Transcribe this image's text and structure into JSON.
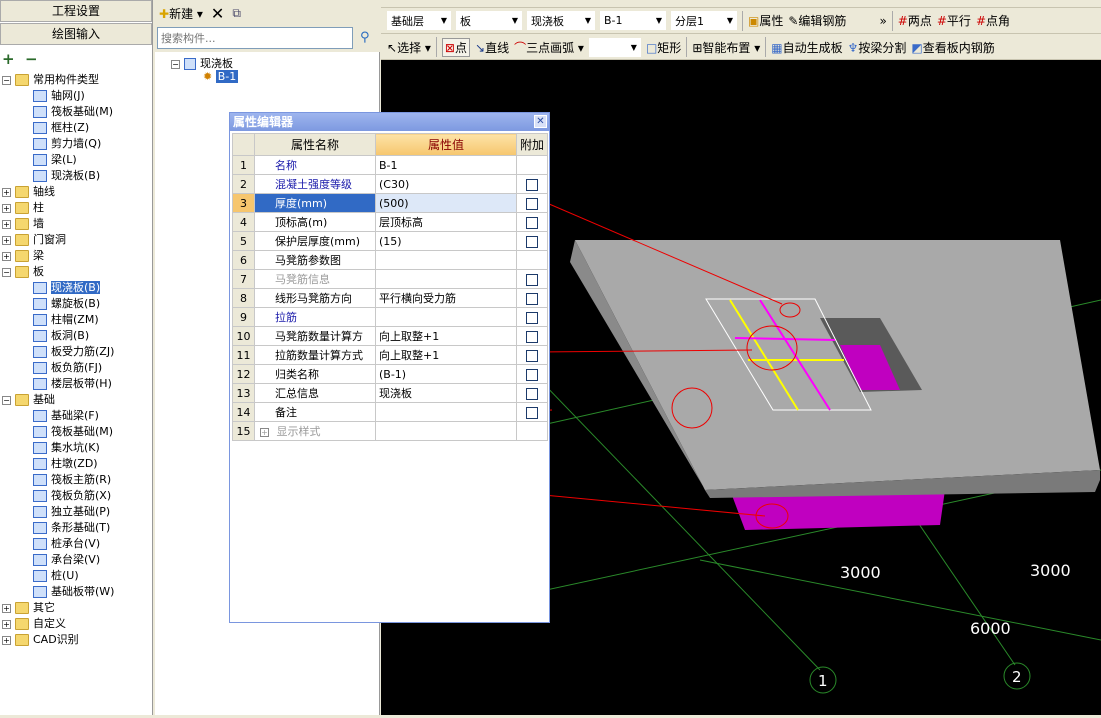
{
  "left": {
    "btn_project": "工程设置",
    "btn_draw": "绘图输入",
    "toolbar": [
      "+",
      "−"
    ],
    "tree": [
      {
        "label": "常用构件类型",
        "level": 0,
        "type": "folder",
        "expanded": true
      },
      {
        "label": "轴网(J)",
        "level": 1
      },
      {
        "label": "筏板基础(M)",
        "level": 1
      },
      {
        "label": "框柱(Z)",
        "level": 1
      },
      {
        "label": "剪力墙(Q)",
        "level": 1
      },
      {
        "label": "梁(L)",
        "level": 1
      },
      {
        "label": "现浇板(B)",
        "level": 1
      },
      {
        "label": "轴线",
        "level": 0,
        "type": "folder"
      },
      {
        "label": "柱",
        "level": 0,
        "type": "folder"
      },
      {
        "label": "墙",
        "level": 0,
        "type": "folder"
      },
      {
        "label": "门窗洞",
        "level": 0,
        "type": "folder"
      },
      {
        "label": "梁",
        "level": 0,
        "type": "folder"
      },
      {
        "label": "板",
        "level": 0,
        "type": "folder",
        "expanded": true
      },
      {
        "label": "现浇板(B)",
        "level": 1,
        "selected": true
      },
      {
        "label": "螺旋板(B)",
        "level": 1
      },
      {
        "label": "柱帽(ZM)",
        "level": 1
      },
      {
        "label": "板洞(B)",
        "level": 1
      },
      {
        "label": "板受力筋(ZJ)",
        "level": 1
      },
      {
        "label": "板负筋(FJ)",
        "level": 1
      },
      {
        "label": "楼层板带(H)",
        "level": 1
      },
      {
        "label": "基础",
        "level": 0,
        "type": "folder",
        "expanded": true
      },
      {
        "label": "基础梁(F)",
        "level": 1
      },
      {
        "label": "筏板基础(M)",
        "level": 1
      },
      {
        "label": "集水坑(K)",
        "level": 1
      },
      {
        "label": "柱墩(ZD)",
        "level": 1
      },
      {
        "label": "筏板主筋(R)",
        "level": 1
      },
      {
        "label": "筏板负筋(X)",
        "level": 1
      },
      {
        "label": "独立基础(P)",
        "level": 1
      },
      {
        "label": "条形基础(T)",
        "level": 1
      },
      {
        "label": "桩承台(V)",
        "level": 1
      },
      {
        "label": "承台梁(V)",
        "level": 1
      },
      {
        "label": "桩(U)",
        "level": 1
      },
      {
        "label": "基础板带(W)",
        "level": 1
      },
      {
        "label": "其它",
        "level": 0,
        "type": "folder"
      },
      {
        "label": "自定义",
        "level": 0,
        "type": "folder"
      },
      {
        "label": "CAD识别",
        "level": 0,
        "type": "folder"
      }
    ]
  },
  "mid": {
    "new_label": "新建",
    "search_placeholder": "搜索构件...",
    "tree_root": "现浇板",
    "tree_child": "B-1"
  },
  "toolbar2": {
    "layer": "基础层",
    "type": "板",
    "sub": "现浇板",
    "item": "B-1",
    "floor": "分层1",
    "props": "属性",
    "edit_rebar": "编辑钢筋",
    "more": "»",
    "two_point": "两点",
    "parallel": "平行",
    "point_angle": "点角"
  },
  "toolbar3": {
    "select": "选择",
    "point": "点",
    "line": "直线",
    "arc": "三点画弧",
    "rect": "矩形",
    "smart": "智能布置",
    "auto": "自动生成板",
    "split": "按梁分割",
    "view_rebar": "查看板内钢筋"
  },
  "dialog": {
    "title": "属性编辑器",
    "headers": [
      "属性名称",
      "属性值",
      "附加"
    ],
    "rows": [
      {
        "n": "1",
        "name": "名称",
        "value": "B-1",
        "style": "blue",
        "check": false
      },
      {
        "n": "2",
        "name": "混凝土强度等级",
        "value": "(C30)",
        "style": "blue",
        "check": true
      },
      {
        "n": "3",
        "name": "厚度(mm)",
        "value": "(500)",
        "style": "blue",
        "check": true,
        "current": true
      },
      {
        "n": "4",
        "name": "顶标高(m)",
        "value": "层顶标高",
        "check": true
      },
      {
        "n": "5",
        "name": "保护层厚度(mm)",
        "value": "(15)",
        "check": true
      },
      {
        "n": "6",
        "name": "马凳筋参数图",
        "value": "",
        "check": false
      },
      {
        "n": "7",
        "name": "马凳筋信息",
        "value": "",
        "style": "gray",
        "check": true
      },
      {
        "n": "8",
        "name": "线形马凳筋方向",
        "value": "平行横向受力筋",
        "check": true
      },
      {
        "n": "9",
        "name": "拉筋",
        "value": "",
        "style": "blue",
        "check": true
      },
      {
        "n": "10",
        "name": "马凳筋数量计算方",
        "value": "向上取整+1",
        "check": true
      },
      {
        "n": "11",
        "name": "拉筋数量计算方式",
        "value": "向上取整+1",
        "check": true
      },
      {
        "n": "12",
        "name": "归类名称",
        "value": "(B-1)",
        "check": true
      },
      {
        "n": "13",
        "name": "汇总信息",
        "value": "现浇板",
        "check": true
      },
      {
        "n": "14",
        "name": "备注",
        "value": "",
        "check": true
      },
      {
        "n": "15",
        "name": "显示样式",
        "value": "",
        "style": "gray",
        "check": false,
        "expander": "+"
      }
    ]
  },
  "canvas": {
    "dims": [
      "3000",
      "3000",
      "6000"
    ],
    "axes": [
      "1",
      "2"
    ]
  }
}
